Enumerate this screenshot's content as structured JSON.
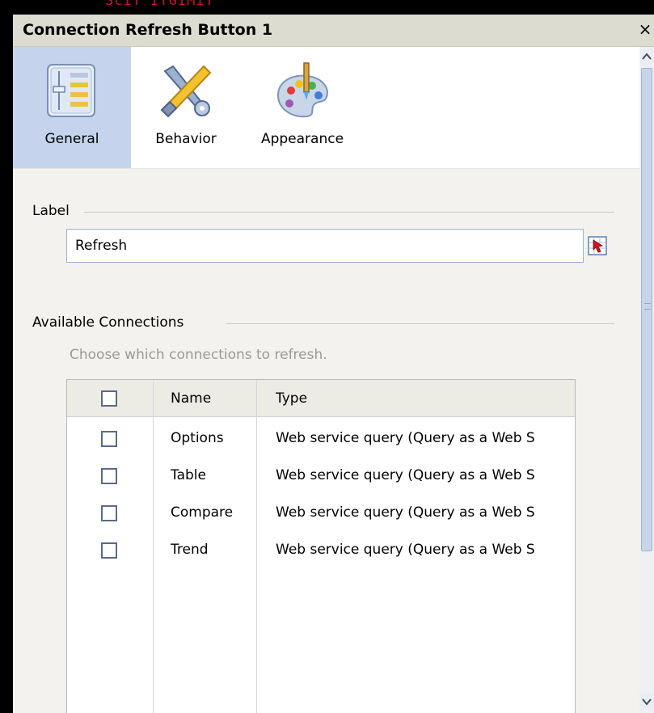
{
  "background_code_fragment": "ScIT ITGIMIT",
  "window": {
    "title": "Connection Refresh Button 1",
    "close_glyph": "×"
  },
  "tabs": [
    {
      "label": "General",
      "icon": "general-settings-icon",
      "active": true
    },
    {
      "label": "Behavior",
      "icon": "tools-icon",
      "active": false
    },
    {
      "label": "Appearance",
      "icon": "palette-icon",
      "active": false
    }
  ],
  "label_section": {
    "heading": "Label",
    "value": "Refresh",
    "picker_icon": "cell-reference-picker-icon"
  },
  "connections_section": {
    "heading": "Available Connections",
    "hint": "Choose which connections to refresh.",
    "columns": [
      "",
      "Name",
      "Type"
    ],
    "rows": [
      {
        "checked": false,
        "name": "Options",
        "type": "Web service query (Query as a Web S"
      },
      {
        "checked": false,
        "name": "Table",
        "type": "Web service query (Query as a Web S"
      },
      {
        "checked": false,
        "name": "Compare",
        "type": "Web service query (Query as a Web S"
      },
      {
        "checked": false,
        "name": "Trend",
        "type": "Web service query (Query as a Web S"
      }
    ]
  },
  "colors": {
    "active_tab": "#c5d4ec",
    "title_bar": "#dcdcd0",
    "content_bg": "#f3f2ee",
    "accent_border": "#9ab3d3"
  }
}
